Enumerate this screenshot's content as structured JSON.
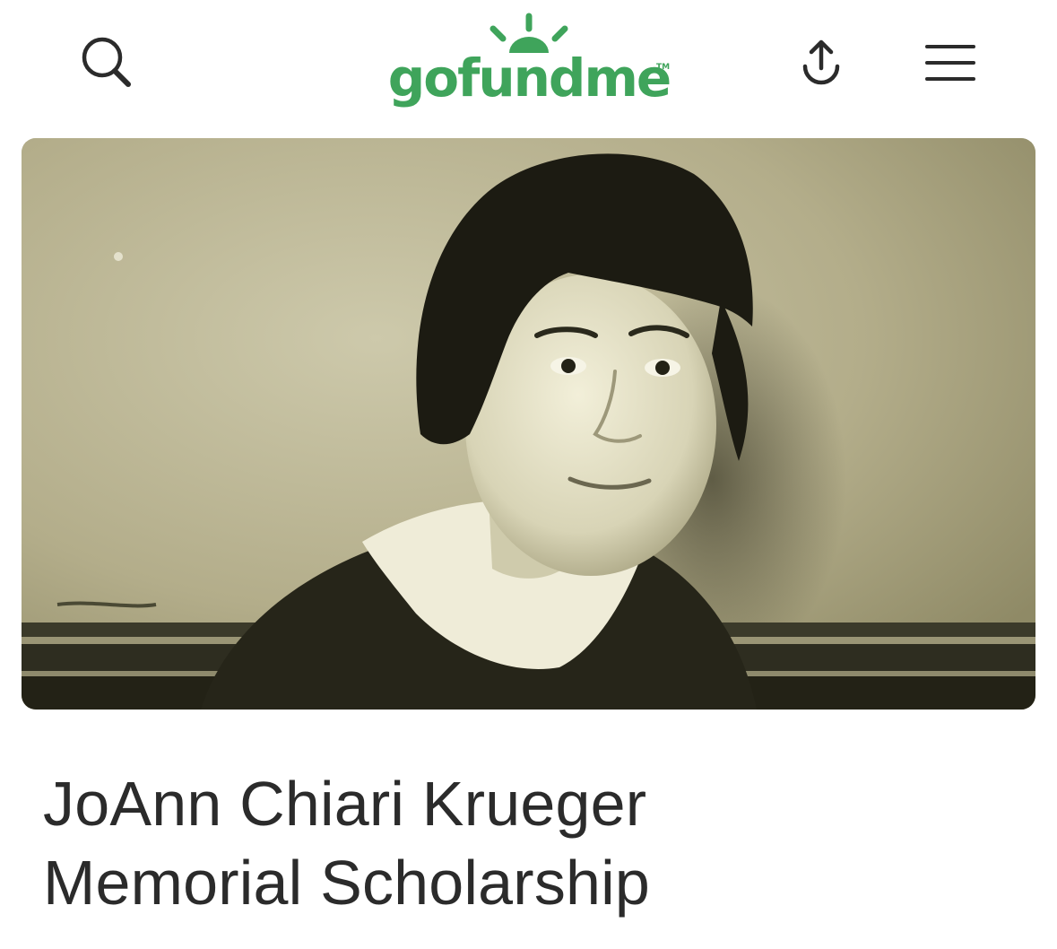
{
  "header": {
    "search_icon": "search-icon",
    "logo_text": "gofundme",
    "logo_tm": "TM",
    "share_icon": "share-icon",
    "menu_icon": "hamburger-menu-icon",
    "brand_color": "#3fa45b"
  },
  "campaign": {
    "title_line1": "JoAnn Chiari Krueger",
    "title_line2": "Memorial Scholarship"
  }
}
